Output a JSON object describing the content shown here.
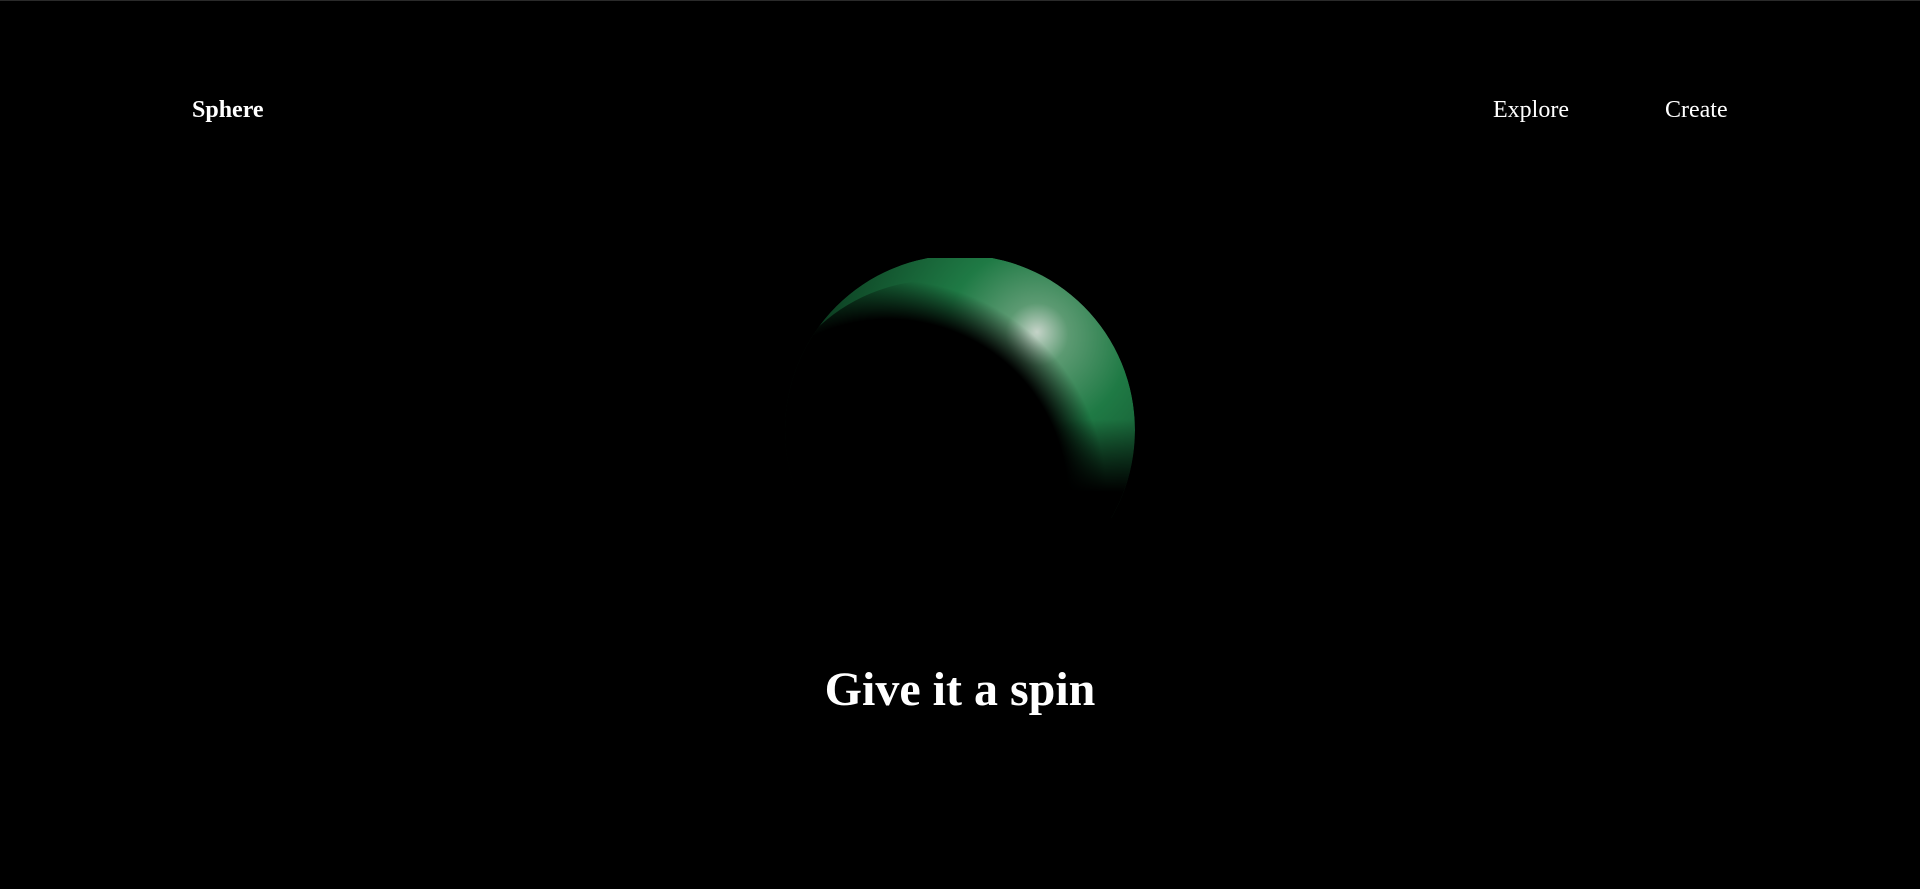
{
  "header": {
    "logo": "Sphere",
    "nav": {
      "explore": "Explore",
      "create": "Create"
    }
  },
  "hero": {
    "sphere": {
      "color": "#1f7a45",
      "highlight": "#b9c9bd",
      "icon": "green-crescent-sphere"
    },
    "headline": "Give it a spin"
  },
  "colors": {
    "background": "#000000",
    "text": "#ffffff"
  }
}
